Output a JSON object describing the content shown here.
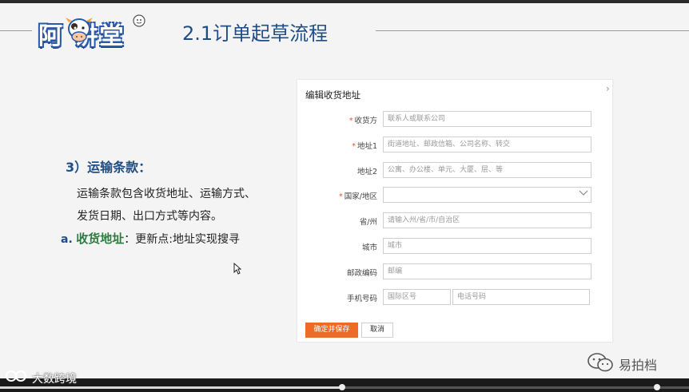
{
  "slide": {
    "title": "2.1订单起草流程",
    "logo_text": "阿 讲堂",
    "section_heading": "3）运输条款：",
    "body_line1": "运输条款包含收货地址、运输方式、",
    "body_line2": "发货日期、出口方式等内容。",
    "item_a_marker": "a.",
    "item_a_highlight": "收货地址",
    "item_a_rest": "：更新点:地址实现搜寻"
  },
  "form": {
    "title": "编辑收货地址",
    "fields": [
      {
        "label": "收货方",
        "required": true,
        "placeholder": "联系人或联系公司"
      },
      {
        "label": "地址1",
        "required": true,
        "placeholder": "街道地址、邮政信箱、公司名称、转交"
      },
      {
        "label": "地址2",
        "required": false,
        "placeholder": "公寓、办公楼、单元、大厦、层、等"
      },
      {
        "label": "国家/地区",
        "required": true,
        "placeholder": ""
      },
      {
        "label": "省/州",
        "required": false,
        "placeholder": "请输入州/省/市/自治区"
      },
      {
        "label": "城市",
        "required": false,
        "placeholder": "城市"
      },
      {
        "label": "邮政编码",
        "required": false,
        "placeholder": "邮编"
      },
      {
        "label": "手机号码",
        "required": false,
        "placeholder_country": "国际区号",
        "placeholder_phone": "电话号码"
      }
    ],
    "save_label": "确定并保存",
    "cancel_label": "取消"
  },
  "watermark": {
    "right_text": "易拍档",
    "left_text": "大数跨境"
  },
  "player": {
    "progress": 0.5
  },
  "colors": {
    "title_blue": "#1f4d86",
    "highlight_green": "#2e7a3e",
    "save_orange": "#ef6a25",
    "required_red": "#e0552a"
  }
}
